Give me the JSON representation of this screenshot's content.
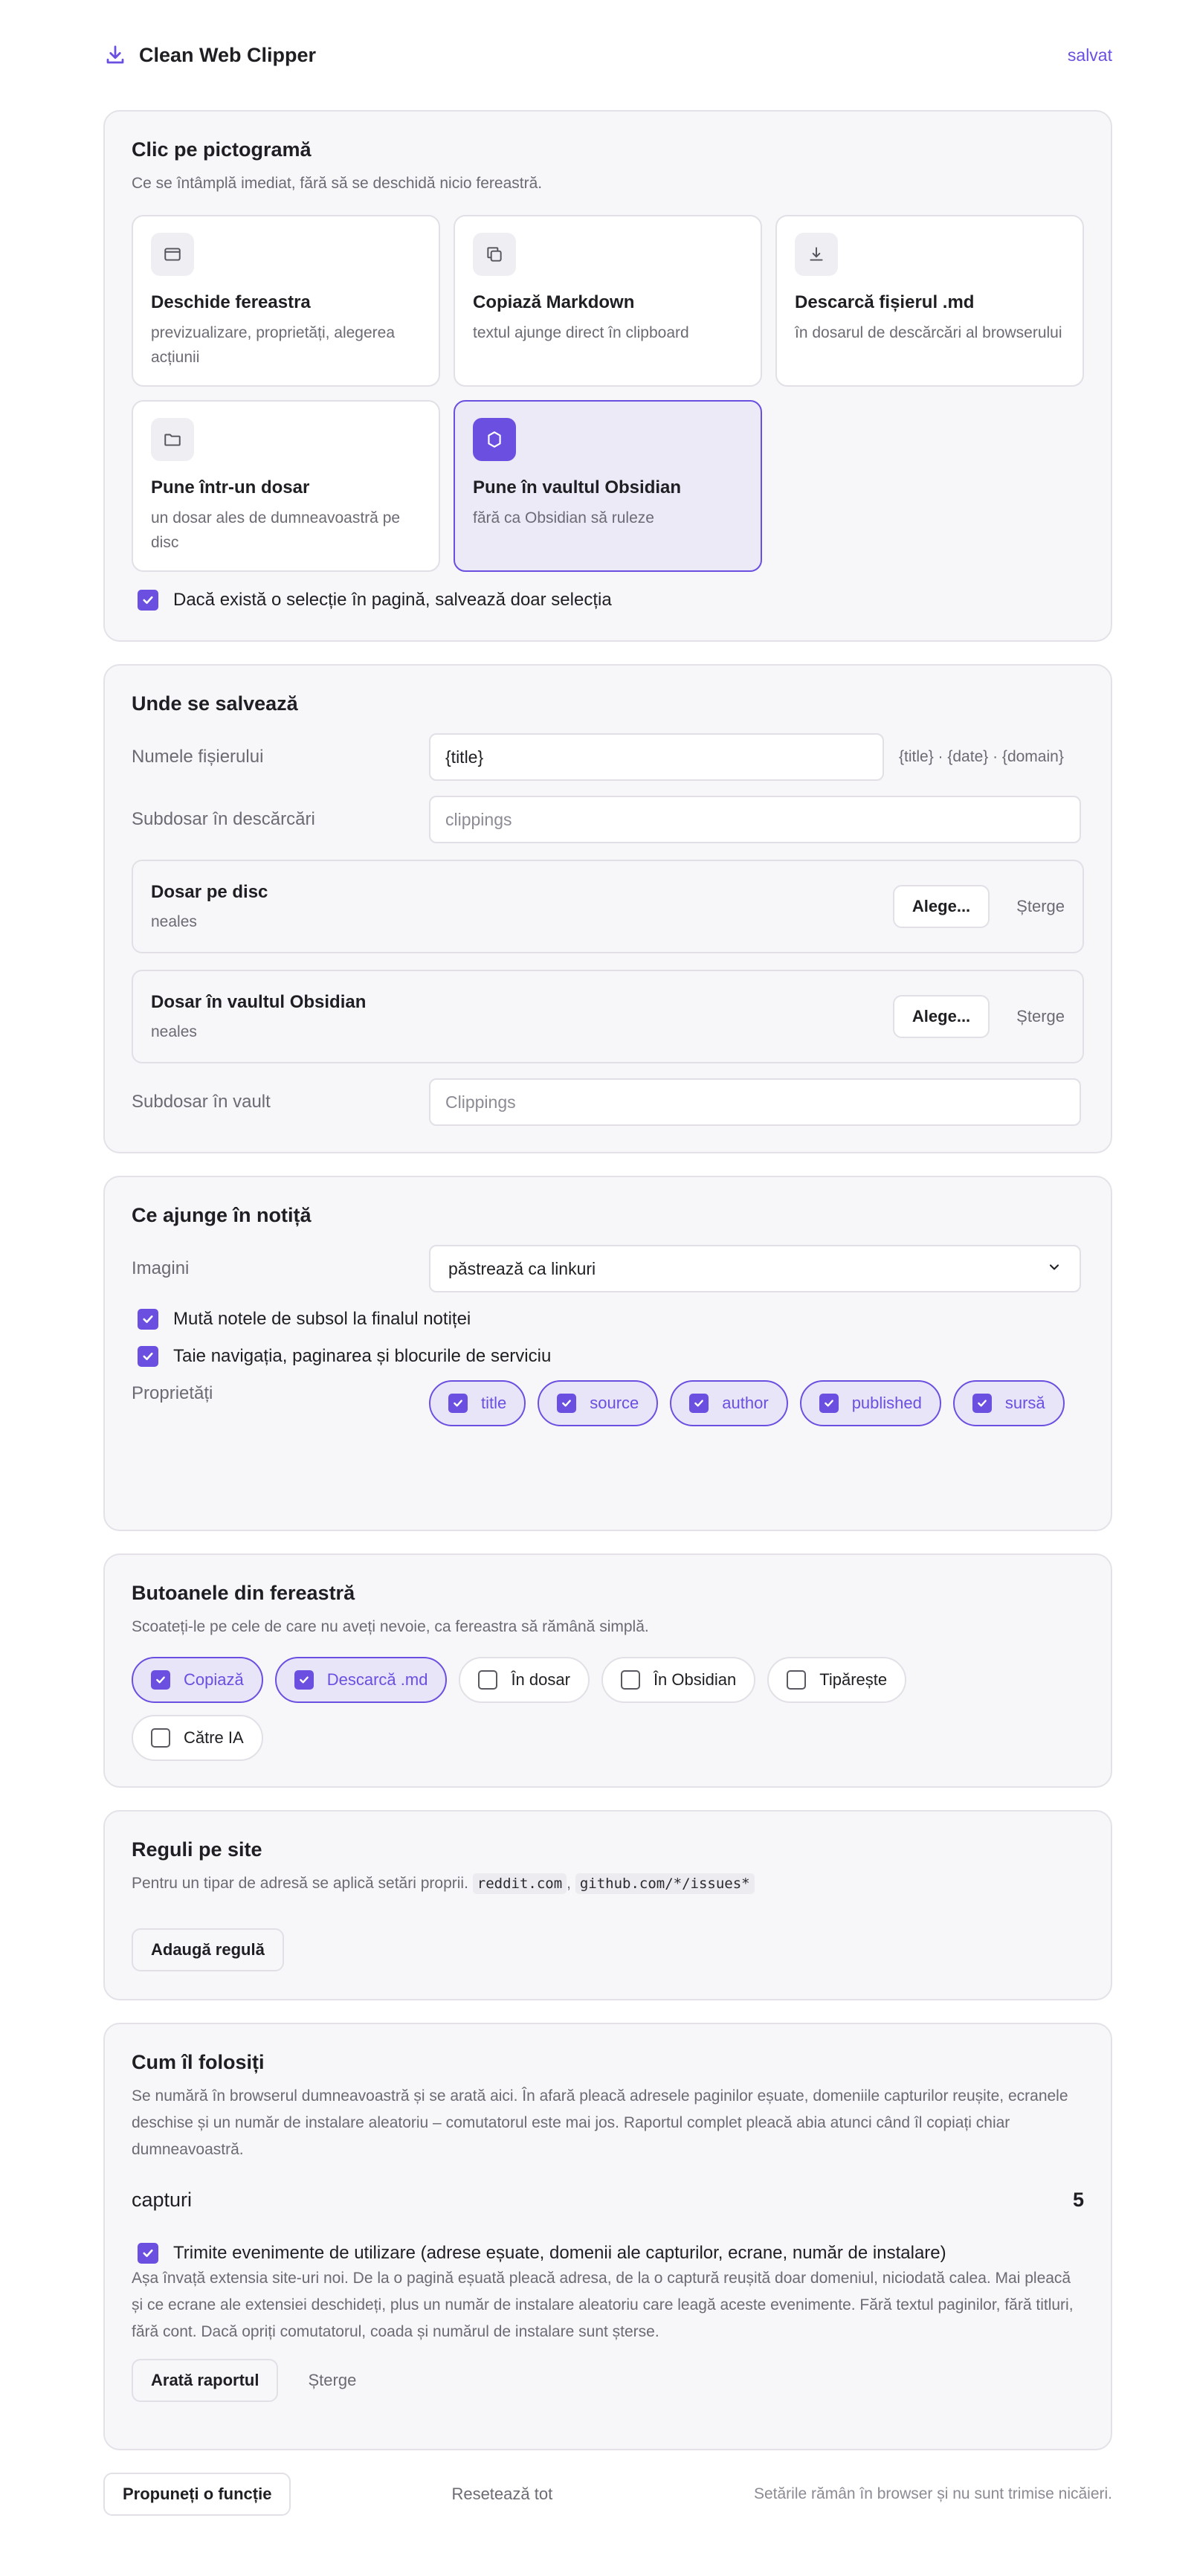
{
  "header": {
    "app_name": "Clean Web Clipper",
    "status": "salvat"
  },
  "icon_click": {
    "title": "Clic pe pictogramă",
    "subtitle": "Ce se întâmplă imediat, fără să se deschidă nicio fereastră.",
    "tiles": [
      {
        "icon": "window-icon",
        "title": "Deschide fereastra",
        "desc": "previzualizare, proprietăți, alegerea acțiunii",
        "selected": false
      },
      {
        "icon": "copy-icon",
        "title": "Copiază Markdown",
        "desc": "textul ajunge direct în clipboard",
        "selected": false
      },
      {
        "icon": "download-icon",
        "title": "Descarcă fișierul .md",
        "desc": "în dosarul de descărcări al browserului",
        "selected": false
      },
      {
        "icon": "folder-icon",
        "title": "Pune într-un dosar",
        "desc": "un dosar ales de dumneavoastră pe disc",
        "selected": false
      },
      {
        "icon": "obsidian-icon",
        "title": "Pune în vaultul Obsidian",
        "desc": "fără ca Obsidian să ruleze",
        "selected": true
      }
    ],
    "selection_only": {
      "label": "Dacă există o selecție în pagină, salvează doar selecția",
      "checked": true
    }
  },
  "save": {
    "title": "Unde se salvează",
    "filename": {
      "label": "Numele fișierului",
      "value": "{title}",
      "hint": "{title} · {date} · {domain}"
    },
    "subfolder": {
      "label": "Subdosar în descărcări",
      "placeholder": "clippings"
    },
    "disk_folder": {
      "title": "Dosar pe disc",
      "value": "neales",
      "choose": "Alege...",
      "clear": "Șterge"
    },
    "vault_folder": {
      "title": "Dosar în vaultul Obsidian",
      "value": "neales",
      "choose": "Alege...",
      "clear": "Șterge"
    },
    "vault_subfolder": {
      "label": "Subdosar în vault",
      "placeholder": "Clippings"
    }
  },
  "note": {
    "title": "Ce ajunge în notiță",
    "images": {
      "label": "Imagini",
      "value": "păstrează ca linkuri"
    },
    "footnotes": {
      "label": "Mută notele de subsol la finalul notiței",
      "checked": true
    },
    "strip": {
      "label": "Taie navigația, paginarea și blocurile de serviciu",
      "checked": true
    },
    "properties": {
      "label": "Proprietăți",
      "items": [
        {
          "label": "title",
          "checked": true
        },
        {
          "label": "source",
          "checked": true
        },
        {
          "label": "author",
          "checked": true
        },
        {
          "label": "published",
          "checked": true
        },
        {
          "label": "sursă",
          "checked": true
        }
      ]
    }
  },
  "buttons": {
    "title": "Butoanele din fereastră",
    "subtitle": "Scoateți-le pe cele de care nu aveți nevoie, ca fereastra să rămână simplă.",
    "items": [
      {
        "label": "Copiază",
        "checked": true
      },
      {
        "label": "Descarcă .md",
        "checked": true
      },
      {
        "label": "În dosar",
        "checked": false
      },
      {
        "label": "În Obsidian",
        "checked": false
      },
      {
        "label": "Tipărește",
        "checked": false
      },
      {
        "label": "Către IA",
        "checked": false
      }
    ]
  },
  "rules": {
    "title": "Reguli pe site",
    "subtitle": "Pentru un tipar de adresă se aplică setări proprii.",
    "example1": "reddit.com",
    "sep": ",",
    "example2": "github.com/*/issues*",
    "add_button": "Adaugă regulă"
  },
  "usage": {
    "title": "Cum îl folosiți",
    "description": "Se numără în browserul dumneavoastră și se arată aici. În afară pleacă adresele paginilor eșuate, domeniile capturilor reușite, ecranele deschise și un număr de instalare aleatoriu – comutatorul este mai jos. Raportul complet pleacă abia atunci când îl copiați chiar dumneavoastră.",
    "stat_label": "capturi",
    "stat_value": "5",
    "telemetry": {
      "label": "Trimite evenimente de utilizare (adrese eșuate, domenii ale capturilor, ecrane, număr de instalare)",
      "checked": true,
      "desc": "Așa învață extensia site-uri noi. De la o pagină eșuată pleacă adresa, de la o captură reușită doar domeniul, niciodată calea. Mai pleacă și ce ecrane ale extensiei deschideți, plus un număr de instalare aleatoriu care leagă aceste evenimente. Fără textul paginilor, fără titluri, fără cont. Dacă opriți comutatorul, coada și numărul de instalare sunt șterse."
    },
    "report_button": "Arată raportul",
    "clear": "Șterge"
  },
  "footer": {
    "suggest": "Propuneți o funcție",
    "reset": "Resetează tot",
    "note": "Setările rămân în browser și nu sunt trimise nicăieri."
  },
  "colors": {
    "accent": "#6b4fe0",
    "accent_soft": "#edeaf8",
    "card_bg": "#f7f6f9"
  }
}
